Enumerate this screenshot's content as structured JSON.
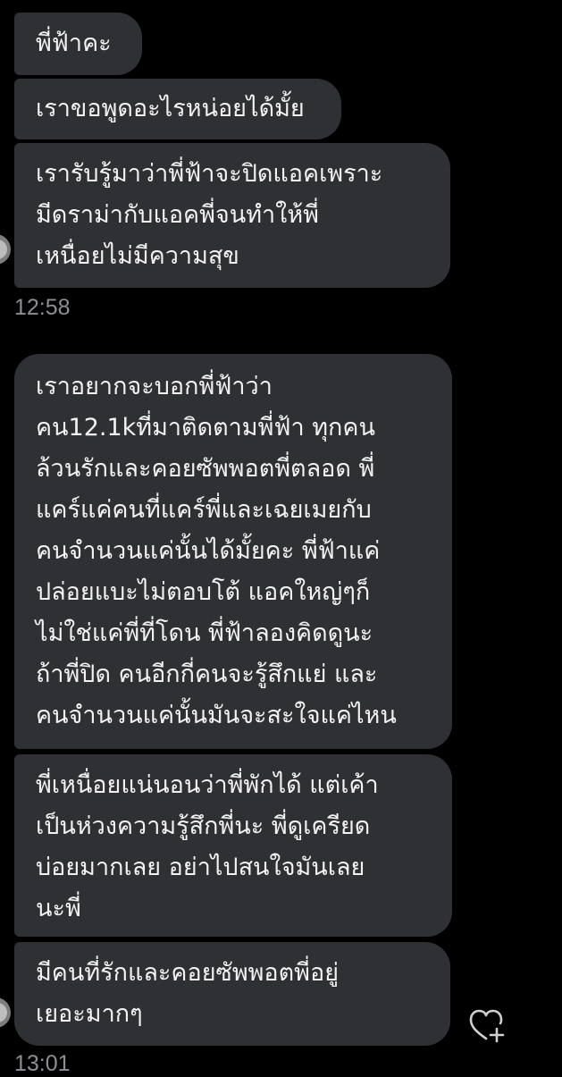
{
  "messages": [
    {
      "lines": [
        "พี่ฟ้าคะ"
      ]
    },
    {
      "lines": [
        "เราขอพูดอะไรหน่อยได้มั้ย"
      ]
    },
    {
      "lines": [
        "เรารับรู้มาว่าพี่ฟ้าจะปิดแอคเพราะ",
        "มีดราม่ากับแอคพี่จนทำให้พี่",
        "เหนื่อยไม่มีความสุข"
      ]
    },
    {
      "lines": [
        "เราอยากจะบอกพี่ฟ้าว่า",
        "คน12.1kที่มาติดตามพี่ฟ้า ทุกคน",
        "ล้วนรักและคอยซัพพอตพี่ตลอด พี่",
        "แคร์แค่คนที่แคร์พี่และเฉยเมยกับ",
        "คนจำนวนแค่นั้นได้มั้ยคะ พี่ฟ้าแค่",
        "ปล่อยแบะไม่ตอบโต้ แอคใหญ่ๆก็",
        "ไม่ใช่แค่พี่ที่โดน พี่ฟ้าลองคิดดูนะ",
        "ถ้าพี่ปิด คนอีกกี่คนจะรู้สึกแย่ และ",
        "คนจำนวนแค่นั้นมันจะสะใจแค่ไหน"
      ]
    },
    {
      "lines": [
        "พี่เหนื่อยแน่นอนว่าพี่พักได้ แต่เค้า",
        "เป็นห่วงความรู้สึกพี่นะ พี่ดูเครียด",
        "บ่อยมากเลย อย่าไปสนใจมันเลย",
        "นะพี่"
      ]
    },
    {
      "lines": [
        "มีคนที่รักและคอยซัพพอตพี่อยู่",
        "เยอะมากๆ"
      ]
    }
  ],
  "timestamps": [
    "12:58",
    "13:01"
  ],
  "icons": {
    "like": "heart-plus-icon",
    "avatar": "avatar"
  },
  "colors": {
    "background": "#000000",
    "bubble": "#2f3033",
    "text": "#f2f2f2",
    "timestamp": "#8b8e93"
  }
}
